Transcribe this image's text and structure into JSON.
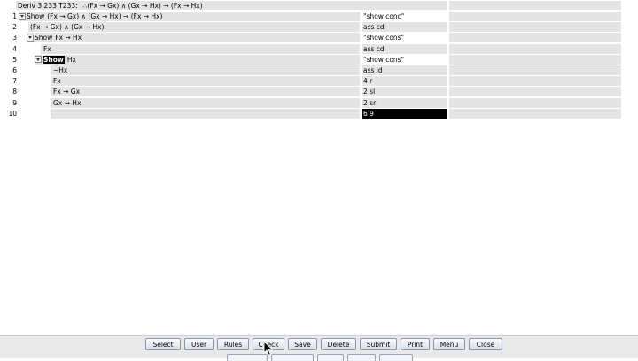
{
  "header": {
    "name": "Deriv 3.233 T233:",
    "formula": "∴(Fx → Gx) ∧ (Gx → Hx) → (Fx → Hx)"
  },
  "rows": [
    {
      "num": "1",
      "show": "Show",
      "formula": "(Fx → Gx) ∧ (Gx → Hx) → (Fx → Hx)",
      "just": "\"show conc\""
    },
    {
      "num": "2",
      "show": "",
      "formula": "(Fx → Gx) ∧ (Gx → Hx)",
      "just": "ass cd"
    },
    {
      "num": "3",
      "show": "Show",
      "formula": "Fx → Hx",
      "just": "\"show cons\""
    },
    {
      "num": "4",
      "show": "",
      "formula": "Fx",
      "just": "ass cd"
    },
    {
      "num": "5",
      "show": "Show",
      "formula": "Hx",
      "just": "\"show cons\""
    },
    {
      "num": "6",
      "show": "",
      "formula": "~Hx",
      "just": "ass id"
    },
    {
      "num": "7",
      "show": "",
      "formula": "Fx",
      "just": "4 r"
    },
    {
      "num": "8",
      "show": "",
      "formula": "Fx → Gx",
      "just": "2 sl"
    },
    {
      "num": "9",
      "show": "",
      "formula": "Gx → Hx",
      "just": "2 sr"
    },
    {
      "num": "10",
      "show": "",
      "formula": "",
      "just": "6 9"
    }
  ],
  "toolbar": {
    "select": "Select",
    "user": "User",
    "rules": "Rules",
    "check": "Check",
    "save": "Save",
    "delete": "Delete",
    "submit": "Submit",
    "print": "Print",
    "menu": "Menu",
    "close": "Close"
  },
  "colors": {
    "cell": "#e4e4e4",
    "active": "#000000",
    "button_border": "#8a96aa"
  },
  "icons": {
    "toggle": "chevron-down-icon",
    "pointer": "arrow-cursor-icon"
  }
}
